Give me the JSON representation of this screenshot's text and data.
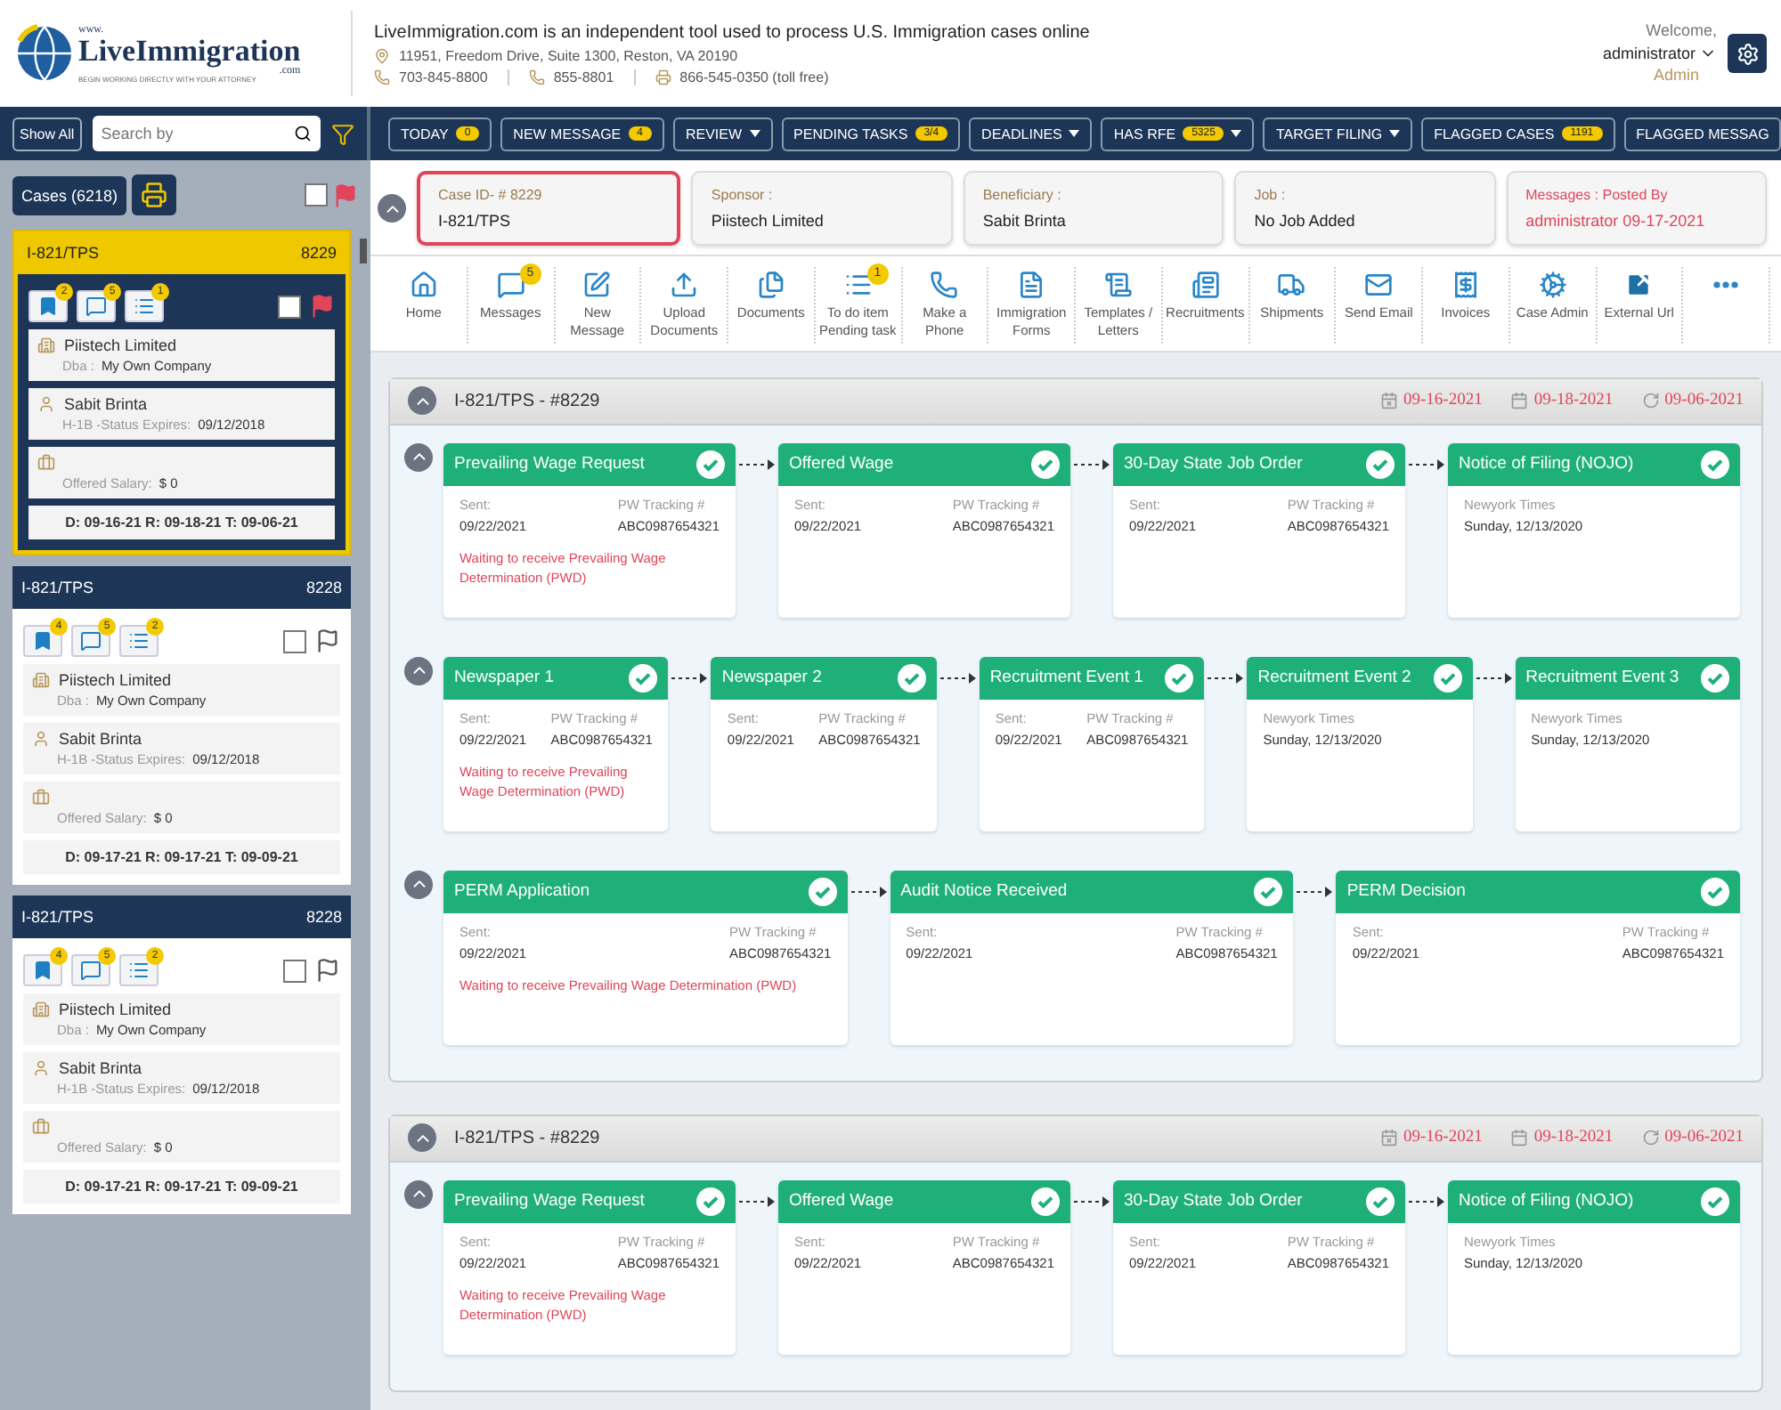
{
  "header": {
    "logo": {
      "prefix": "www.",
      "name": "LiveImmigration",
      "suffix": ".com",
      "tagline": "BEGIN WORKING DIRECTLY WITH YOUR ATTORNEY"
    },
    "title": "LiveImmigration.com is an independent tool used to process U.S. Immigration cases online",
    "address": "11951, Freedom Drive, Suite 1300, Reston, VA 20190",
    "contacts": [
      {
        "kind": "phone",
        "value": "703-845-8800"
      },
      {
        "kind": "phone",
        "value": "855-8801"
      },
      {
        "kind": "fax",
        "value": "866-545-0350 (toll free)"
      }
    ],
    "welcome": "Welcome,",
    "user": "administrator",
    "role": "Admin"
  },
  "toolbar": {
    "show_all": "Show All",
    "search": {
      "placeholder": "Search by"
    },
    "filters": [
      {
        "label": "TODAY",
        "count": "0",
        "dropdown": false
      },
      {
        "label": "NEW MESSAGE",
        "count": "4",
        "dropdown": false
      },
      {
        "label": "REVIEW",
        "dropdown": true
      },
      {
        "label": "PENDING TASKS",
        "count": "3/4",
        "dropdown": false
      },
      {
        "label": "DEADLINES",
        "dropdown": true
      },
      {
        "label": "HAS RFE",
        "count": "5325",
        "dropdown": true
      },
      {
        "label": "TARGET FILING",
        "dropdown": true
      },
      {
        "label": "FLAGGED CASES",
        "count": "1191",
        "dropdown": false
      },
      {
        "label": "FLAGGED MESSAG",
        "dropdown": false
      }
    ]
  },
  "sidebar": {
    "cases_button": "Cases (6218)",
    "select_all": {
      "checked": false,
      "flagged": true
    },
    "cases": [
      {
        "type": "I-821/TPS",
        "number": "8229",
        "selected": true,
        "checked": false,
        "flagged": true,
        "badges": [
          "2",
          "5",
          "1"
        ],
        "company": "Piistech Limited",
        "dba_label": "Dba :",
        "dba": "My Own Company",
        "person": "Sabit Brinta",
        "status_label": "H-1B -Status Expires:",
        "status_date": "09/12/2018",
        "salary_label": "Offered Salary:",
        "salary": "$ 0",
        "dates": "D: 09-16-21 R: 09-18-21 T: 09-06-21"
      },
      {
        "type": "I-821/TPS",
        "number": "8228",
        "selected": false,
        "checked": false,
        "flagged": false,
        "badges": [
          "4",
          "5",
          "2"
        ],
        "company": "Piistech Limited",
        "dba_label": "Dba :",
        "dba": "My Own Company",
        "person": "Sabit Brinta",
        "status_label": "H-1B -Status Expires:",
        "status_date": "09/12/2018",
        "salary_label": "Offered Salary:",
        "salary": "$ 0",
        "dates": "D: 09-17-21 R: 09-17-21 T: 09-09-21"
      },
      {
        "type": "I-821/TPS",
        "number": "8228",
        "selected": false,
        "checked": false,
        "flagged": false,
        "badges": [
          "4",
          "5",
          "2"
        ],
        "company": "Piistech Limited",
        "dba_label": "Dba :",
        "dba": "My Own Company",
        "person": "Sabit Brinta",
        "status_label": "H-1B -Status Expires:",
        "status_date": "09/12/2018",
        "salary_label": "Offered Salary:",
        "salary": "$ 0",
        "dates": "D: 09-17-21 R: 09-17-21 T: 09-09-21"
      }
    ]
  },
  "summary": [
    {
      "label": "Case ID- # 8229",
      "value": "I-821/TPS",
      "selected": true,
      "kind": "plain"
    },
    {
      "label": "Sponsor :",
      "value": "Piistech Limited",
      "selected": false,
      "kind": "plain"
    },
    {
      "label": "Beneficiary :",
      "value": "Sabit Brinta",
      "selected": false,
      "kind": "plain"
    },
    {
      "label": "Job :",
      "value": "No Job Added",
      "selected": false,
      "kind": "plain"
    },
    {
      "label": "Messages : Posted By",
      "value": "administrator 09-17-2021",
      "selected": false,
      "kind": "alert"
    }
  ],
  "actions": [
    {
      "kind": "home",
      "label": "Home"
    },
    {
      "kind": "messages",
      "label": "Messages",
      "badge": "5"
    },
    {
      "kind": "compose",
      "label": "New Message"
    },
    {
      "kind": "upload",
      "label": "Upload Documents"
    },
    {
      "kind": "documents",
      "label": "Documents"
    },
    {
      "kind": "tasks",
      "label": "To do item Pending task",
      "badge": "1"
    },
    {
      "kind": "phone",
      "label": "Make a Phone"
    },
    {
      "kind": "form",
      "label": "Immigration Forms"
    },
    {
      "kind": "scroll",
      "label": "Templates / Letters"
    },
    {
      "kind": "newspaper",
      "label": "Recruitments"
    },
    {
      "kind": "truck",
      "label": "Shipments"
    },
    {
      "kind": "mail",
      "label": "Send Email"
    },
    {
      "kind": "receipt",
      "label": "Invoices"
    },
    {
      "kind": "gears",
      "label": "Case Admin"
    },
    {
      "kind": "external",
      "label": "External Url"
    },
    {
      "kind": "more"
    }
  ],
  "sections": [
    {
      "title": "I-821/TPS - #8229",
      "dates": [
        {
          "kind": "due",
          "value": "09-16-2021"
        },
        {
          "kind": "calendar",
          "value": "09-18-2021"
        },
        {
          "kind": "target",
          "value": "09-06-2021"
        }
      ],
      "stages": [
        {
          "steps": [
            {
              "title": "Prevailing Wage Request",
              "done": true,
              "fields": [
                {
                  "label": "Sent:",
                  "value": "09/22/2021"
                },
                {
                  "label": "PW Tracking #",
                  "value": "ABC0987654321"
                }
              ],
              "note": "Waiting to receive Prevailing Wage Determination (PWD)"
            },
            {
              "title": "Offered Wage",
              "done": true,
              "fields": [
                {
                  "label": "Sent:",
                  "value": "09/22/2021"
                },
                {
                  "label": "PW Tracking #",
                  "value": "ABC0987654321"
                }
              ]
            },
            {
              "title": "30-Day State Job Order",
              "done": true,
              "fields": [
                {
                  "label": "Sent:",
                  "value": "09/22/2021"
                },
                {
                  "label": "PW Tracking #",
                  "value": "ABC0987654321"
                }
              ]
            },
            {
              "title": "Notice of Filing (NOJO)",
              "done": true,
              "fields": [
                {
                  "label": "Newyork Times",
                  "value": "Sunday, 12/13/2020"
                }
              ]
            }
          ]
        },
        {
          "steps": [
            {
              "title": "Newspaper 1",
              "done": true,
              "fields": [
                {
                  "label": "Sent:",
                  "value": "09/22/2021"
                },
                {
                  "label": "PW Tracking #",
                  "value": "ABC0987654321"
                }
              ],
              "note": "Waiting to receive Prevailing Wage Determination (PWD)"
            },
            {
              "title": "Newspaper 2",
              "done": true,
              "fields": [
                {
                  "label": "Sent:",
                  "value": "09/22/2021"
                },
                {
                  "label": "PW Tracking #",
                  "value": "ABC0987654321"
                }
              ]
            },
            {
              "title": "Recruitment Event 1",
              "done": true,
              "fields": [
                {
                  "label": "Sent:",
                  "value": "09/22/2021"
                },
                {
                  "label": "PW Tracking #",
                  "value": "ABC0987654321"
                }
              ]
            },
            {
              "title": "Recruitment Event 2",
              "done": true,
              "fields": [
                {
                  "label": "Newyork Times",
                  "value": "Sunday, 12/13/2020"
                }
              ]
            },
            {
              "title": "Recruitment Event 3",
              "done": true,
              "fields": [
                {
                  "label": "Newyork Times",
                  "value": "Sunday, 12/13/2020"
                }
              ]
            }
          ]
        },
        {
          "steps": [
            {
              "title": "PERM Application",
              "done": true,
              "fields": [
                {
                  "label": "Sent:",
                  "value": "09/22/2021"
                },
                {
                  "label": "PW Tracking #",
                  "value": "ABC0987654321"
                }
              ],
              "note": "Waiting to receive Prevailing Wage Determination (PWD)"
            },
            {
              "title": "Audit Notice Received",
              "done": true,
              "fields": [
                {
                  "label": "Sent:",
                  "value": "09/22/2021"
                },
                {
                  "label": "PW Tracking #",
                  "value": "ABC0987654321"
                }
              ]
            },
            {
              "title": "PERM Decision",
              "done": true,
              "fields": [
                {
                  "label": "Sent:",
                  "value": "09/22/2021"
                },
                {
                  "label": "PW Tracking #",
                  "value": "ABC0987654321"
                }
              ]
            }
          ]
        }
      ]
    },
    {
      "title": "I-821/TPS - #8229",
      "dates": [
        {
          "kind": "due",
          "value": "09-16-2021"
        },
        {
          "kind": "calendar",
          "value": "09-18-2021"
        },
        {
          "kind": "target",
          "value": "09-06-2021"
        }
      ],
      "stages": [
        {
          "steps": [
            {
              "title": "Prevailing Wage Request",
              "done": true,
              "fields": [
                {
                  "label": "Sent:",
                  "value": "09/22/2021"
                },
                {
                  "label": "PW Tracking #",
                  "value": "ABC0987654321"
                }
              ],
              "note": "Waiting to receive Prevailing Wage Determination (PWD)"
            },
            {
              "title": "Offered Wage",
              "done": true,
              "fields": [
                {
                  "label": "Sent:",
                  "value": "09/22/2021"
                },
                {
                  "label": "PW Tracking #",
                  "value": "ABC0987654321"
                }
              ]
            },
            {
              "title": "30-Day State Job Order",
              "done": true,
              "fields": [
                {
                  "label": "Sent:",
                  "value": "09/22/2021"
                },
                {
                  "label": "PW Tracking #",
                  "value": "ABC0987654321"
                }
              ]
            },
            {
              "title": "Notice of Filing (NOJO)",
              "done": true,
              "fields": [
                {
                  "label": "Newyork Times",
                  "value": "Sunday, 12/13/2020"
                }
              ]
            }
          ]
        }
      ]
    }
  ]
}
